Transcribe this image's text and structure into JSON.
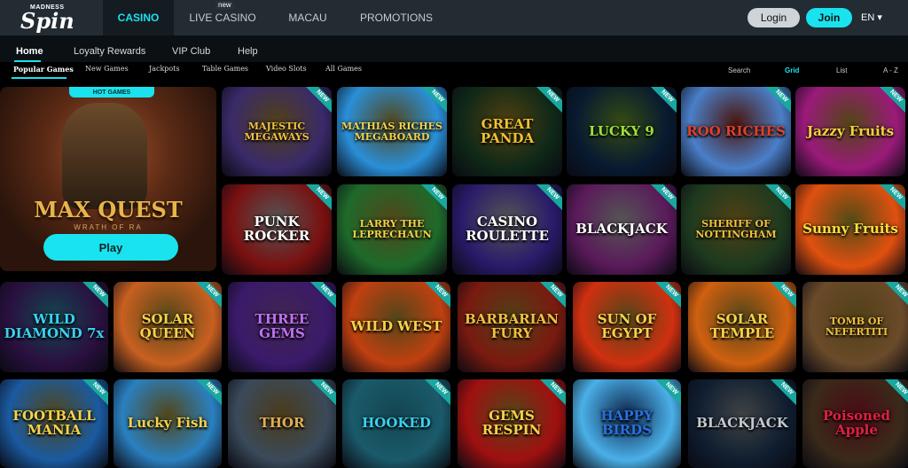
{
  "header": {
    "logo_top": "MADNESS",
    "logo_main": "Spin",
    "nav": [
      {
        "label": "CASINO",
        "active": true
      },
      {
        "label": "LIVE CASINO",
        "badge": "new"
      },
      {
        "label": "MACAU"
      },
      {
        "label": "PROMOTIONS"
      }
    ],
    "login_label": "Login",
    "join_label": "Join",
    "lang": "EN ▾"
  },
  "subnav": [
    "Home",
    "Loyalty Rewards",
    "VIP Club",
    "Help"
  ],
  "filters": [
    "Popular Games",
    "New Games",
    "Jackpots",
    "Table Games",
    "Video Slots",
    "All Games"
  ],
  "view": {
    "search": "Search",
    "grid": "Grid",
    "list": "List",
    "az": "A - Z"
  },
  "hero": {
    "badge": "HOT GAMES",
    "title": "MAX QUEST",
    "subtitle": "WRATH OF RA",
    "play_label": "Play"
  },
  "new_tag": "NEW",
  "games": [
    {
      "title": "MAJESTIC MEGAWAYS",
      "color": "#3a2a6a",
      "accent": "#f0c040"
    },
    {
      "title": "MATHIAS RICHES MEGABOARD",
      "color": "#2a8fd8",
      "accent": "#f5d24a"
    },
    {
      "title": "GREAT PANDA",
      "color": "#0f2818",
      "accent": "#f0c030"
    },
    {
      "title": "LUCKY 9",
      "color": "#081a30",
      "accent": "#9ce03a"
    },
    {
      "title": "ROO RICHES",
      "color": "#4a7fc8",
      "accent": "#e0402a"
    },
    {
      "title": "Jazzy Fruits",
      "color": "#9a1a7a",
      "accent": "#f5d23a"
    },
    {
      "title": "PUNK ROCKER",
      "color": "#7a1010",
      "accent": "#ffffff"
    },
    {
      "title": "LARRY THE LEPRECHAUN",
      "color": "#1e6a2a",
      "accent": "#f5d24a"
    },
    {
      "title": "CASINO ROULETTE",
      "color": "#2a1a6a",
      "accent": "#ffffff"
    },
    {
      "title": "BLACKJACK",
      "color": "#5a1a5a",
      "accent": "#ffffff"
    },
    {
      "title": "SHERIFF OF NOTTINGHAM",
      "color": "#1e3a1e",
      "accent": "#f0c040"
    },
    {
      "title": "Sunny Fruits",
      "color": "#e05010",
      "accent": "#f5e040"
    },
    {
      "title": "WILD DIAMOND 7x",
      "color": "#2a1040",
      "accent": "#3ad0f0"
    },
    {
      "title": "SOLAR QUEEN",
      "color": "#c86020",
      "accent": "#f5d24a"
    },
    {
      "title": "THREE GEMS",
      "color": "#3a1a6a",
      "accent": "#c070f0"
    },
    {
      "title": "WILD WEST",
      "color": "#c04010",
      "accent": "#f5d24a"
    },
    {
      "title": "BARBARIAN FURY",
      "color": "#7a1a10",
      "accent": "#f0c040"
    },
    {
      "title": "SUN OF EGYPT",
      "color": "#d03010",
      "accent": "#f5d24a"
    },
    {
      "title": "SOLAR TEMPLE",
      "color": "#d06010",
      "accent": "#f5d24a"
    },
    {
      "title": "TOMB OF NEFERTITI",
      "color": "#6a4a2a",
      "accent": "#f0c040"
    },
    {
      "title": "FOOTBALL MANIA",
      "color": "#1a5aa0",
      "accent": "#f5d24a"
    },
    {
      "title": "Lucky Fish",
      "color": "#2a80c0",
      "accent": "#f5d24a"
    },
    {
      "title": "THOR",
      "color": "#3a4a5a",
      "accent": "#e0b050"
    },
    {
      "title": "HOOKED",
      "color": "#1a5a6a",
      "accent": "#3ad0f0"
    },
    {
      "title": "GEMS RESPIN",
      "color": "#a01010",
      "accent": "#f5d24a"
    },
    {
      "title": "HAPPY BIRDS",
      "color": "#4ab0e8",
      "accent": "#2a70e0"
    },
    {
      "title": "BLACKJACK",
      "color": "#0f1e30",
      "accent": "#c0c8d0"
    },
    {
      "title": "Poisoned Apple",
      "color": "#3a2a1a",
      "accent": "#e02040"
    }
  ]
}
